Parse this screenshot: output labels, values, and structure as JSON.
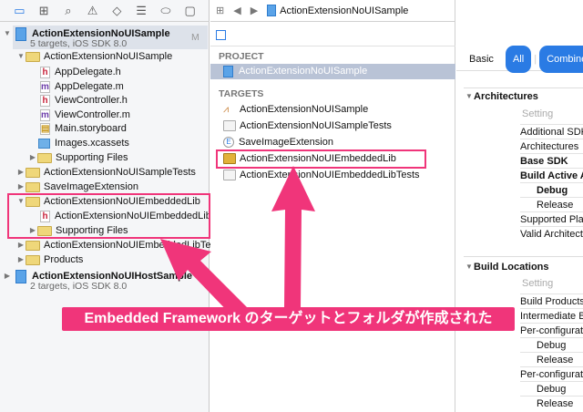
{
  "navigator": {
    "project": {
      "name": "ActionExtensionNoUISample",
      "subtitle": "5 targets, iOS SDK 8.0",
      "badge": "M"
    },
    "items": [
      "ActionExtensionNoUISample",
      "AppDelegate.h",
      "AppDelegate.m",
      "ViewController.h",
      "ViewController.m",
      "Main.storyboard",
      "Images.xcassets",
      "Supporting Files",
      "ActionExtensionNoUISampleTests",
      "SaveImageExtension",
      "ActionExtensionNoUIEmbeddedLib",
      "ActionExtensionNoUIEmbeddedLib.h",
      "Supporting Files",
      "ActionExtensionNoUIEmbeddedLibTests",
      "Products"
    ],
    "project2": {
      "name": "ActionExtensionNoUIHostSample",
      "subtitle": "2 targets, iOS SDK 8.0"
    }
  },
  "editor": {
    "breadcrumb": "ActionExtensionNoUISample",
    "project_header": "PROJECT",
    "project": "ActionExtensionNoUISample",
    "targets_header": "TARGETS",
    "targets": [
      "ActionExtensionNoUISample",
      "ActionExtensionNoUISampleTests",
      "SaveImageExtension",
      "ActionExtensionNoUIEmbeddedLib",
      "ActionExtensionNoUIEmbeddedLibTests"
    ]
  },
  "settings": {
    "filters": [
      "Basic",
      "All",
      "Combined"
    ],
    "arch": {
      "title": "Architectures",
      "col": "Setting",
      "rows": [
        "Additional SDKs",
        "Architectures",
        "Base SDK",
        "Build Active Architecture Only",
        "Debug",
        "Release",
        "Supported Platforms",
        "Valid Architectures"
      ]
    },
    "loc": {
      "title": "Build Locations",
      "col": "Setting",
      "rows": [
        "Build Products Path",
        "Intermediate Build Files Path",
        "Per-configuration Build Products Path",
        "Debug",
        "Release",
        "Per-configuration Intermediate Build Files Path",
        "Debug",
        "Release"
      ]
    }
  },
  "annotation": "Embedded Framework のターゲットとフォルダが作成された",
  "colors": {
    "accent": "#2a7be4",
    "highlight": "#f0357a"
  }
}
